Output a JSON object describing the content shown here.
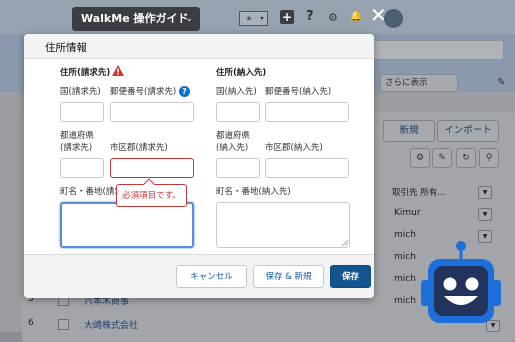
{
  "walkme": {
    "label": "WalkMe 操作ガイド",
    "chevron": "⌄"
  },
  "header_icons": {
    "star": "★",
    "dropdown": "▾",
    "plus": "+",
    "help": "?",
    "gear": "⚙",
    "bell": "🔔"
  },
  "background": {
    "view_selector": "さらに表示",
    "buttons": {
      "new": "新規",
      "import": "インポート"
    },
    "column_header": "取引先 所有...",
    "cells": [
      "Kimur",
      "mich",
      "mich",
      "mich",
      "mich"
    ],
    "rows": [
      {
        "num": "5",
        "name": "六本木商事"
      },
      {
        "num": "6",
        "name": "大崎株式会社"
      }
    ]
  },
  "modal": {
    "title": "住所情報",
    "billing": {
      "heading": "住所(請求先)",
      "country_label": "国(請求先)",
      "postal_label": "郵便番号(請求先)",
      "state_label_1": "都道府県",
      "state_label_2": "(請求先)",
      "city_label": "市区郡(請求先)",
      "street_label": "町名・番地(請求先)"
    },
    "shipping": {
      "heading": "住所(納入先)",
      "country_label": "国(納入先)",
      "postal_label": "郵便番号(納入先)",
      "state_label_1": "都道府県",
      "state_label_2": "(納入先)",
      "city_label": "市区郡(納入先)",
      "street_label": "町名・番地(納入先)"
    },
    "error_message": "必須項目です。",
    "buttons": {
      "cancel": "キャンセル",
      "save_new": "保存 & 新規",
      "save": "保存"
    }
  },
  "colors": {
    "brand": "#12558f",
    "error": "#c23934",
    "focus": "#5a8fd6",
    "walkme_bar": "#3a3d42",
    "robot_blue": "#1e6fd9"
  }
}
